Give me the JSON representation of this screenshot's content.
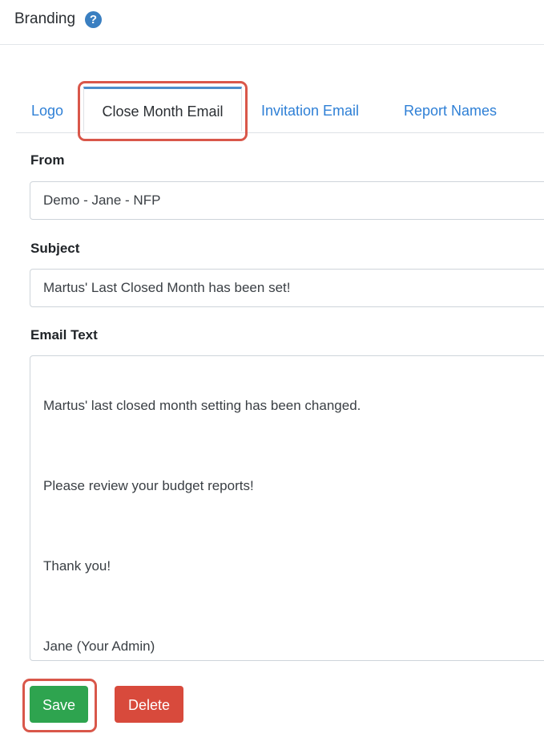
{
  "header": {
    "title": "Branding",
    "help_icon": "?"
  },
  "tabs": [
    {
      "label": "Logo",
      "active": false
    },
    {
      "label": "Close Month Email",
      "active": true
    },
    {
      "label": "Invitation Email",
      "active": false
    },
    {
      "label": "Report Names",
      "active": false
    }
  ],
  "form": {
    "from_label": "From",
    "from_value": "Demo - Jane - NFP",
    "subject_label": "Subject",
    "subject_value": "Martus' Last Closed Month has been set!",
    "email_text_label": "Email Text",
    "email_text_lines": [
      "Martus' last closed month setting has been changed.",
      "Please review your budget reports!",
      "Thank you!",
      "Jane (Your Admin)"
    ]
  },
  "buttons": {
    "save_label": "Save",
    "delete_label": "Delete"
  },
  "colors": {
    "save": "#2ea44f",
    "delete": "#d84a3c",
    "highlight": "#d9574a",
    "link": "#2f80d6"
  }
}
